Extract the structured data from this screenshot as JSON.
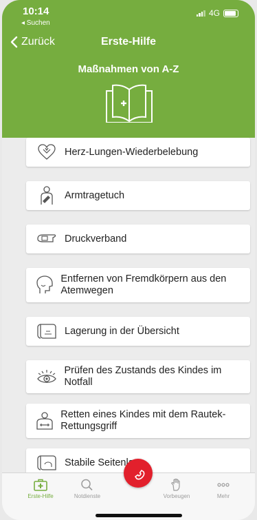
{
  "status_bar": {
    "time": "10:14",
    "back_label": "◂ Suchen",
    "network": "4G"
  },
  "nav": {
    "back_label": "Zurück",
    "title": "Erste-Hilfe"
  },
  "header": {
    "subtitle": "Maßnahmen von A-Z",
    "icon": "first-aid-book-icon"
  },
  "items": [
    {
      "label": "Herz-Lungen-Wiederbelebung",
      "icon": "heart-hands-icon"
    },
    {
      "label": "Armtragetuch",
      "icon": "arm-sling-icon"
    },
    {
      "label": "Druckverband",
      "icon": "bandage-icon"
    },
    {
      "label": "Entfernen von Fremdkörpern aus den Atemwegen",
      "icon": "head-airway-icon"
    },
    {
      "label": "Lagerung in der Übersicht",
      "icon": "positioning-icon"
    },
    {
      "label": "Prüfen des Zustands des Kindes im Notfall",
      "icon": "eye-icon"
    },
    {
      "label": "Retten eines Kindes mit dem Rautek-Rettungsgriff",
      "icon": "rescue-grip-icon"
    },
    {
      "label": "Stabile Seitenlage",
      "icon": "recovery-position-icon"
    }
  ],
  "tabs": [
    {
      "label": "Erste-Hilfe",
      "icon": "first-aid-kit-icon",
      "active": true
    },
    {
      "label": "Notdienste",
      "icon": "search-icon",
      "active": false
    },
    {
      "label": "Vorbeugen",
      "icon": "hand-icon",
      "active": false
    },
    {
      "label": "Mehr",
      "icon": "more-icon",
      "active": false
    }
  ],
  "fab": {
    "icon": "phone-icon"
  },
  "colors": {
    "brand_green": "#76ad3f",
    "emergency_red": "#e2202c"
  }
}
